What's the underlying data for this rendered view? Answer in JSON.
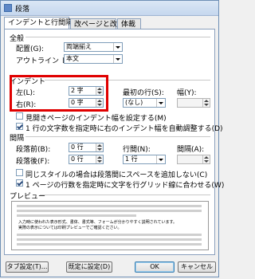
{
  "window": {
    "title": "段落"
  },
  "tabs": [
    {
      "label": "インデントと行間隔",
      "active": true
    },
    {
      "label": "改ページと改行",
      "active": false
    },
    {
      "label": "体裁",
      "active": false
    }
  ],
  "general": {
    "header": "全般",
    "alignment_label": "配置(G):",
    "alignment_value": "両端揃え",
    "outline_label": "アウトライン レベル(O):",
    "outline_value": "本文"
  },
  "indent": {
    "header": "インデント",
    "left_label": "左(L):",
    "left_value": "2 字",
    "right_label": "右(R):",
    "right_value": "0 字",
    "first_line_label": "最初の行(S):",
    "first_line_value": "(なし)",
    "by_label": "幅(Y):",
    "by_value": "",
    "mirror_label": "見開きページのインデント幅を設定する(M)",
    "mirror_checked": false,
    "auto_adjust_label": "1 行の文字数を指定時に右のインデント幅を自動調整する(D)",
    "auto_adjust_checked": true
  },
  "spacing": {
    "header": "間隔",
    "before_label": "段落前(B):",
    "before_value": "0 行",
    "after_label": "段落後(F):",
    "after_value": "0 行",
    "line_spacing_label": "行間(N):",
    "line_spacing_value": "1 行",
    "at_label": "間隔(A):",
    "at_value": "",
    "no_space_label": "同じスタイルの場合は段落間にスペースを追加しない(C)",
    "no_space_checked": false,
    "grid_label": "1 ページの行数を指定時に文字を行グリッド線に合わせる(W)",
    "grid_checked": true
  },
  "preview": {
    "header": "プレビュー",
    "sample_line1": "入力時に使われた表示形式、書体、書式等、フォームが分かりやすく説明されています。",
    "sample_line2": "実際の表示については印刷プレビューでご確認ください。"
  },
  "buttons": {
    "tabs": "タブ設定(T)...",
    "default": "既定に設定(D)",
    "ok": "OK",
    "cancel": "キャンセル"
  },
  "colors": {
    "highlight": "#e00000",
    "accent": "#3c7fb1"
  }
}
